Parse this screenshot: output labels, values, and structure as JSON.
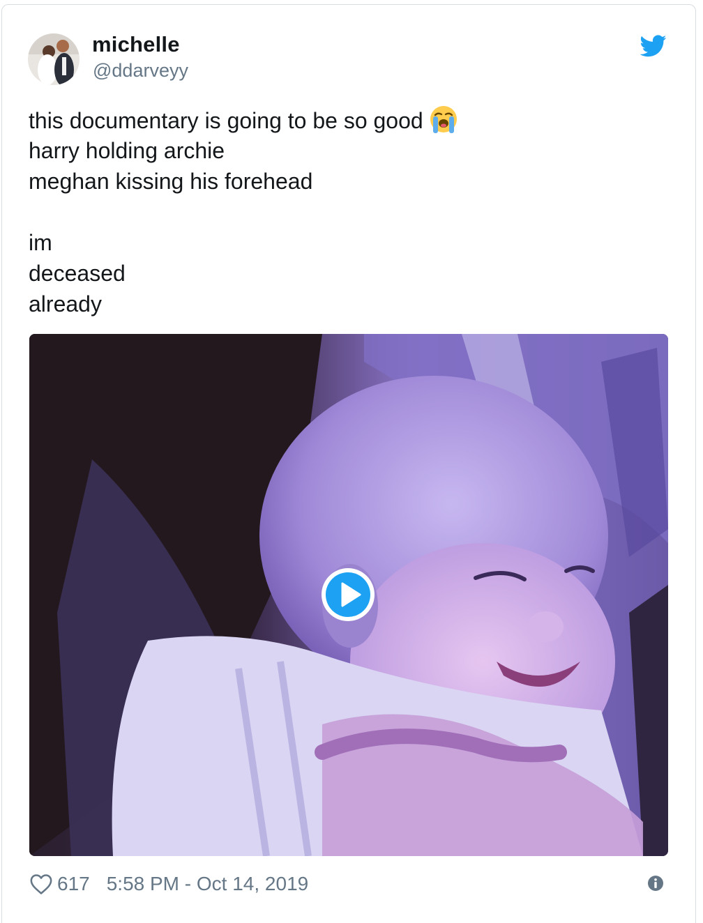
{
  "tweet": {
    "display_name": "michelle",
    "handle": "@ddarveyy",
    "text_lines": [
      "this documentary is going to be so good",
      "harry holding archie",
      "meghan kissing his forehead",
      "",
      "im",
      "deceased",
      "already"
    ],
    "emoji_icon": "loudly-crying-face-icon",
    "likes": "617",
    "timestamp": "5:58 PM - Oct 14, 2019"
  },
  "icons": {
    "brand": "twitter-bird-icon",
    "like": "heart-icon",
    "info": "info-icon",
    "video": "play-icon"
  },
  "colors": {
    "twitter_blue": "#1da1f2",
    "text": "#14171a",
    "secondary": "#657786",
    "border": "#d8dde2"
  }
}
